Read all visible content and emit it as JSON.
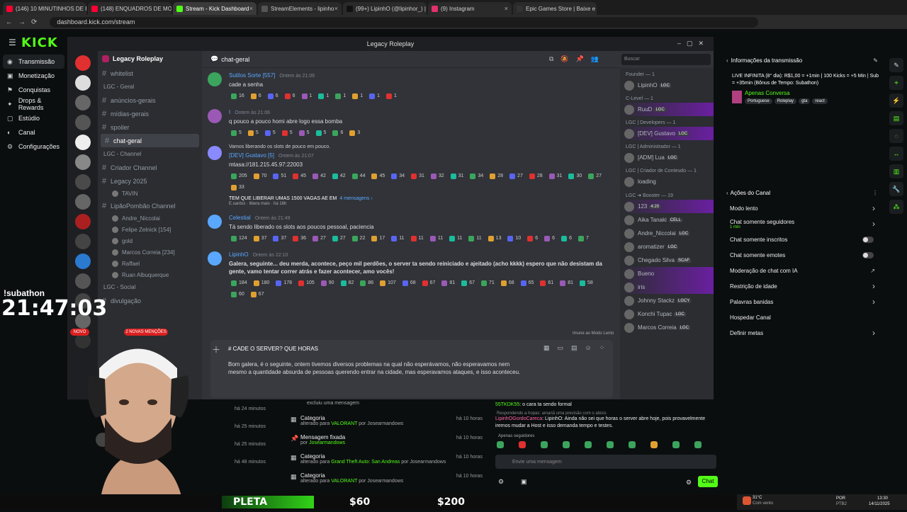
{
  "browser": {
    "tabs": [
      {
        "label": "(146) 10 MINUTINHOS DE FOR",
        "color": "#ff0033"
      },
      {
        "label": "(148) ENQUADROS DE MOTO",
        "color": "#ff0033"
      },
      {
        "label": "Stream - Kick Dashboard",
        "color": "#53fc18"
      },
      {
        "label": "StreamElements - lipinho",
        "color": "#555"
      },
      {
        "label": "(99+) LipinhO (@lipinhor_) | Tik",
        "color": "#111"
      },
      {
        "label": "(9) Instagram",
        "color": "#e1306c"
      },
      {
        "label": "Epic Games Store | Baixe e jog",
        "color": "#333"
      }
    ],
    "url": "dashboard.kick.com/stream"
  },
  "kick": {
    "logo": "KICK",
    "nav": [
      {
        "label": "Transmissão",
        "icon": "broadcast-icon"
      },
      {
        "label": "Monetização",
        "icon": "money-icon"
      },
      {
        "label": "Conquistas",
        "icon": "trophy-icon"
      },
      {
        "label": "Drops & Rewards",
        "icon": "gift-icon"
      },
      {
        "label": "Estúdio",
        "icon": "studio-icon"
      },
      {
        "label": "Canal",
        "icon": "user-icon"
      },
      {
        "label": "Configurações",
        "icon": "gear-icon"
      }
    ],
    "info_title": "Informações da transmissão",
    "stream_title": "LIVE INFINITA (8° dia): R$1,00 = +1min | 100 Kicks = +5 Min | Sub = +35min (Bônus de Tempo: Subathon)",
    "category": "Apenas Conversa",
    "tags": [
      "Portuguese",
      "Roleplay",
      "gta",
      "react"
    ],
    "actions_title": "Ações do Canal",
    "actions": [
      {
        "label": "Modo lento",
        "kind": "arrow"
      },
      {
        "label": "Chat somente seguidores",
        "sub": "1 min",
        "kind": "arrow"
      },
      {
        "label": "Chat somente inscritos",
        "kind": "toggle"
      },
      {
        "label": "Chat somente emotes",
        "kind": "toggle"
      },
      {
        "label": "Moderação de chat com IA",
        "kind": "link"
      },
      {
        "label": "Restrição de idade",
        "kind": "arrow"
      },
      {
        "label": "Palavras banidas",
        "kind": "arrow"
      },
      {
        "label": "Hospedar Canal",
        "kind": "none"
      },
      {
        "label": "Definir metas",
        "kind": "arrow"
      }
    ]
  },
  "discord": {
    "window_title": "Legacy Roleplay",
    "server": "Legacy Roleplay",
    "channels": [
      {
        "type": "ch",
        "label": "whitelist"
      },
      {
        "type": "cat",
        "label": "LGC - Geral"
      },
      {
        "type": "ch",
        "label": "anúncios-gerais"
      },
      {
        "type": "ch",
        "label": "mídias-gerais"
      },
      {
        "type": "ch",
        "label": "spoiler"
      },
      {
        "type": "sel",
        "label": "chat-geral"
      },
      {
        "type": "cat",
        "label": "LGC - Channel"
      },
      {
        "type": "ch",
        "label": "Criador Channel"
      },
      {
        "type": "ch",
        "label": "Legacy 2025"
      },
      {
        "type": "subuser",
        "label": "TAVIN"
      },
      {
        "type": "ch",
        "label": "LipãoPombão Channel"
      },
      {
        "type": "subuser",
        "label": "Andre_Niccolai"
      },
      {
        "type": "subuser",
        "label": "Felipe Zelnick [154]"
      },
      {
        "type": "subuser",
        "label": "gold"
      },
      {
        "type": "subuser",
        "label": "Marcos Correia [234]"
      },
      {
        "type": "subuser",
        "label": "Raffael"
      },
      {
        "type": "subuser",
        "label": "Ruan Albuquerque"
      },
      {
        "type": "cat",
        "label": "LGC - Social"
      },
      {
        "type": "ch",
        "label": "divulgação"
      }
    ],
    "channel_header": "chat-geral",
    "search_placeholder": "Buscar",
    "messages": [
      {
        "name": "Sutilos Sorte [557]",
        "time": "Ontem às 21:06",
        "text": "cade a senha",
        "color": "#3ba55d",
        "reacts": [
          "16",
          "6",
          "6",
          "6",
          "1",
          "1",
          "1",
          "1",
          "1",
          "1"
        ]
      },
      {
        "name": "I",
        "time": "Ontem às 21:06",
        "text": "q pouco a pouco homi abre logo essa bomba",
        "color": "#9b59b6",
        "reacts": [
          "5",
          "5",
          "5",
          "5",
          "5",
          "5",
          "6",
          "3"
        ]
      },
      {
        "name": "[DEV] Gustavo [5]",
        "time": "Ontem às 21:07",
        "text": "mtasa://181.215.45.97:22003",
        "color": "#8a8aff",
        "reply": "Vamos liberando os slots de pouco em pouco.",
        "reacts": [
          "205",
          "70",
          "51",
          "45",
          "42",
          "42",
          "44",
          "45",
          "34",
          "31",
          "32",
          "31",
          "34",
          "28",
          "27",
          "28",
          "31",
          "30",
          "27",
          "33"
        ],
        "thread": "TEM QUE LIBERAR UMAS 1500 VAGAS AE EM",
        "thread_count": "4 mensagens ›",
        "thread_last": "E.santos · libera mais · há 16h"
      },
      {
        "name": "Celestial",
        "time": "Ontem às 21:49",
        "text": "Tá sendo liberado os slots aos poucos pessoal, paciencia",
        "color": "#5aa7ff",
        "reacts": [
          "124",
          "37",
          "37",
          "36",
          "27",
          "27",
          "22",
          "17",
          "11",
          "11",
          "11",
          "11",
          "11",
          "13",
          "10",
          "6",
          "6",
          "6",
          "7"
        ]
      },
      {
        "name": "LipinhO",
        "time": "Ontem às 22:10",
        "text": "Galera, seguinte... deu merda, acontece, peço mil perdões, o server ta sendo reiniciado e ajeitado (acho kkkk) espero que não desistam da gente, vamo tentar correr atrás e fazer acontecer, amo vocês!",
        "color": "#5aa7ff",
        "reacts": [
          "184",
          "180",
          "178",
          "105",
          "90",
          "82",
          "86",
          "107",
          "68",
          "67",
          "81",
          "67",
          "71",
          "68",
          "65",
          "61",
          "81",
          "58",
          "60",
          "67"
        ]
      }
    ],
    "slow_mode": "Imune ao Modo Lento",
    "compose_value": "# CADE O SERVER? QUE HORAS",
    "compose_body": "Bom galera, é o seguinte, ontem tivemos diversos problemas na qual não esperávamos, não esperavamos nem mesmo a quantidade absurda de pessoas querendo entrar na cidade, mas esperavamos ataques, e isso aconteceu.",
    "member_groups": [
      {
        "cat": "Founder — 1",
        "members": [
          {
            "name": "LipinhO",
            "tag": "LGC"
          }
        ]
      },
      {
        "cat": "C-Level — 1",
        "members": [
          {
            "name": "RuuD",
            "tag": "LGC",
            "hl": true
          }
        ]
      },
      {
        "cat": "LGC | Developers — 1",
        "members": [
          {
            "name": "[DEV] Gustavo",
            "tag": "LGC",
            "hl": true
          }
        ]
      },
      {
        "cat": "LGC | Administrador — 1",
        "members": [
          {
            "name": "[ADM] Lua",
            "tag": "LGC"
          }
        ]
      },
      {
        "cat": "LGC | Criador de Conteudo — 1",
        "members": [
          {
            "name": "loading",
            "tag": ""
          }
        ]
      },
      {
        "cat": "LGC ➜ Booster — 19",
        "members": [
          {
            "name": "123",
            "tag": "4:20",
            "hl": true
          },
          {
            "name": "Aika Tanaki",
            "tag": "CELL"
          },
          {
            "name": "Andre_Niccolai",
            "tag": "LGC"
          },
          {
            "name": "aromatizer",
            "tag": "LGC"
          },
          {
            "name": "Chegado Silva",
            "tag": "SCAF"
          },
          {
            "name": "Bueno",
            "tag": "",
            "hl": true
          },
          {
            "name": "iris",
            "tag": "",
            "hl": true
          },
          {
            "name": "Johnny Stackz",
            "tag": "LGCY"
          },
          {
            "name": "Konchi Tupac",
            "tag": "LGC"
          },
          {
            "name": "Marcos Correia",
            "tag": "LGC"
          }
        ]
      }
    ]
  },
  "lower_events": [
    {
      "title": "Categoria",
      "sub_pre": "alterado para ",
      "sub_b": "VALORANT",
      "sub_post": " por Josearmandows",
      "when": "há 10 horas",
      "icon": "category-icon"
    },
    {
      "title": "Mensagem fixada",
      "sub_pre": "por ",
      "sub_b": "Josearmandows",
      "sub_post": "",
      "when": "há 10 horas",
      "icon": "pin-icon"
    },
    {
      "title": "Categoria",
      "sub_pre": "alterado para ",
      "sub_b": "Grand Theft Auto: San Andreas",
      "sub_post": " por Josearmandows",
      "when": "há 10 horas",
      "icon": "category-icon"
    },
    {
      "title": "Categoria",
      "sub_pre": "alterado para ",
      "sub_b": "VALORANT",
      "sub_post": " por Josearmandows",
      "when": "há 10 horas",
      "icon": "category-icon"
    }
  ],
  "lower_left_times": [
    "há 24 minutos",
    "há 25 minutos",
    "há 25 minutos",
    "há 48 minutos"
  ],
  "chat": {
    "line1_user": "55TKDK55",
    "line1_text": ": o cara ta sendo formal",
    "reply_note": "Respondendo a hopas: amanã uma previsão com o abisis",
    "line2_user": "LipinhOGordoCareca",
    "line2_text": ": LipinhO: Ainda não sei que horas o server abre hoje, pois provavelmente iremos mudar a Host e isso demanda tempo e testes.",
    "followers_only": "Apenas seguidores",
    "input_placeholder": "Envie uma mensagem",
    "send_label": "Chat"
  },
  "overlay": {
    "subathon": "!subathon",
    "timer": "21:47:03",
    "novo": "NOVO",
    "mentions": "2 NOVAS MENÇÕES",
    "bottom_left": "PLETA",
    "prize1": "$60",
    "prize2": "$200"
  },
  "taskbar": {
    "weather": "31°C",
    "weather_sub": "Com vento",
    "lang": "POR",
    "lang_sub": "PTB2",
    "time": "13:30",
    "date": "14/11/2025"
  }
}
